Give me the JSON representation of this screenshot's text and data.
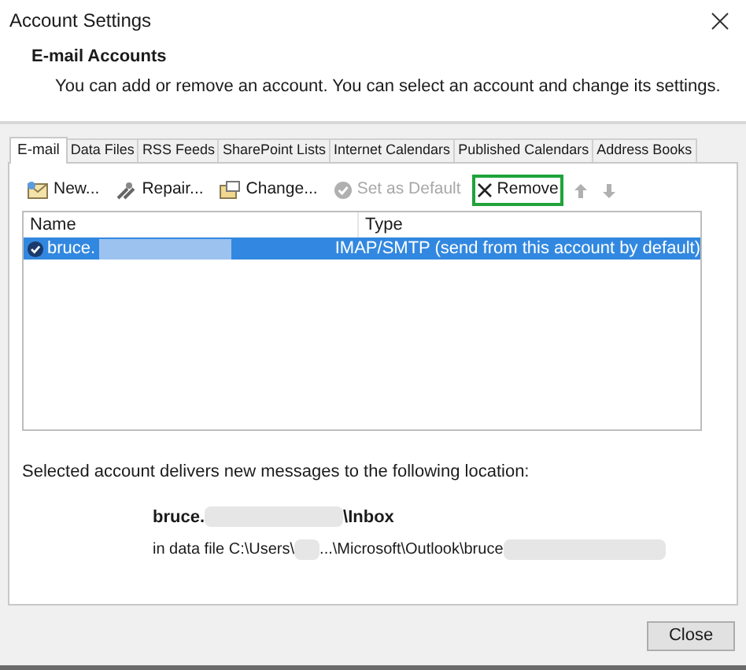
{
  "window": {
    "title": "Account Settings"
  },
  "header": {
    "title": "E-mail Accounts",
    "description": "You can add or remove an account. You can select an account and change its settings."
  },
  "tabs": [
    {
      "label": "E-mail",
      "selected": true
    },
    {
      "label": "Data Files",
      "selected": false
    },
    {
      "label": "RSS Feeds",
      "selected": false
    },
    {
      "label": "SharePoint Lists",
      "selected": false
    },
    {
      "label": "Internet Calendars",
      "selected": false
    },
    {
      "label": "Published Calendars",
      "selected": false
    },
    {
      "label": "Address Books",
      "selected": false
    }
  ],
  "toolbar": [
    {
      "kind": "new",
      "label": "New...",
      "disabled": false,
      "highlighted": false
    },
    {
      "kind": "repair",
      "label": "Repair...",
      "disabled": false,
      "highlighted": false
    },
    {
      "kind": "change",
      "label": "Change...",
      "disabled": false,
      "highlighted": false
    },
    {
      "kind": "default",
      "label": "Set as Default",
      "disabled": true,
      "highlighted": false
    },
    {
      "kind": "remove",
      "label": "Remove",
      "disabled": false,
      "highlighted": true
    },
    {
      "kind": "up",
      "disabled": true,
      "highlighted": false
    },
    {
      "kind": "down",
      "disabled": true,
      "highlighted": false
    }
  ],
  "table": {
    "columns": [
      "Name",
      "Type"
    ],
    "rows": [
      {
        "name": "bruce.",
        "type": "IMAP/SMTP (send from this account by default)",
        "selected": true,
        "default": true
      }
    ]
  },
  "location": {
    "caption": "Selected account delivers new messages to the following location:",
    "folder_start": "bruce.",
    "folder_end": "\\Inbox",
    "file_start": "in data file C:\\Users\\",
    "file_middle": "...\\Microsoft\\Outlook\\bruce"
  },
  "buttons": [
    {
      "label": "Close"
    }
  ]
}
